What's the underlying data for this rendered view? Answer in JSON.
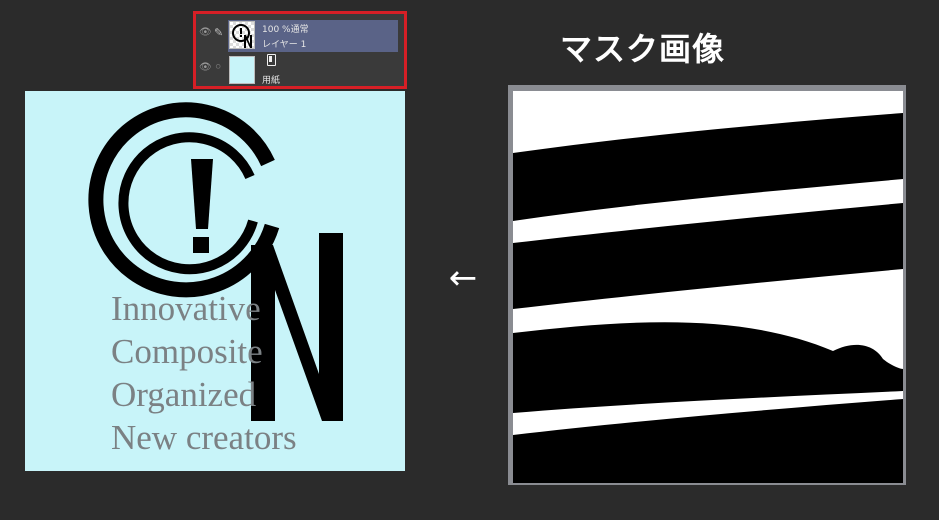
{
  "layer_panel": {
    "layers": [
      {
        "mode": "100 %通常",
        "name": "レイヤー 1",
        "selected": true,
        "visible_icon": "eye-icon",
        "edit_icon": "pen-icon"
      },
      {
        "name": "用紙",
        "selected": false,
        "visible_icon": "eye-icon",
        "edit_icon": "link-icon"
      }
    ],
    "highlight_color": "#d61f26",
    "selected_row_color": "#5a6387"
  },
  "canvas": {
    "background": "#c8f4f9",
    "logo": "copyright-style-exclamation-N-logo",
    "lines": [
      "Innovative",
      "Composite",
      "Organized",
      "New creators"
    ]
  },
  "arrow": "←",
  "mask": {
    "title": "マスク画像"
  }
}
